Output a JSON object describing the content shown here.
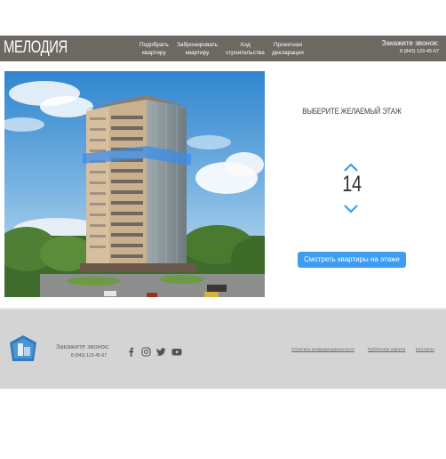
{
  "header": {
    "logo": "МЕЛОДИЯ",
    "nav": [
      {
        "line1": "Подобрать",
        "line2": "квартиру"
      },
      {
        "line1": "Забронировать",
        "line2": "квартиру"
      },
      {
        "line1": "Ход",
        "line2": "строительства"
      },
      {
        "line1": "Проектная",
        "line2": "декларация"
      }
    ],
    "call_label": "Закажите звонок:",
    "call_phone": "8 (843) 123-45-67"
  },
  "floor_selector": {
    "title": "ВЫБЕРИТЕ ЖЕЛАЕМЫЙ ЭТАЖ",
    "floor": "14",
    "button": "Смотреть квартиры на этаже"
  },
  "footer": {
    "call_label": "Закажите звонок:",
    "call_phone": "8 (843) 123-45-67",
    "social_icons": [
      "facebook-icon",
      "instagram-icon",
      "twitter-icon",
      "youtube-icon"
    ],
    "links": [
      "Политика конфиденциальности",
      "Публичная оферта",
      "Контакты"
    ]
  },
  "colors": {
    "header_bg": "#6e6862",
    "accent": "#3d9df2",
    "footer_bg": "#d4d4d4",
    "highlight_floor": "#3a8ee8"
  }
}
